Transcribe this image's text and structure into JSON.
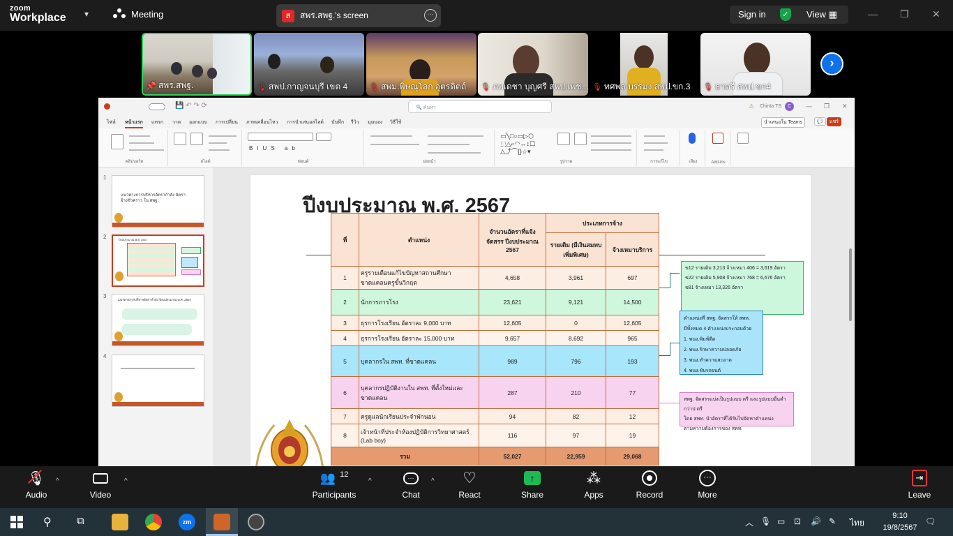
{
  "app": {
    "brand_line1": "zoom",
    "brand_line2": "Workplace",
    "meeting_label": "Meeting",
    "share_badge": "ส",
    "share_title": "สพร.สพฐ.'s screen",
    "signin": "Sign in",
    "view": "View"
  },
  "participants_strip": [
    {
      "name": "สพร.สพฐ.",
      "muted": false,
      "pinned": true
    },
    {
      "name": "สพป.กาญจนบุรี เขต 4",
      "muted": true
    },
    {
      "name": "สพม.พิษณุโลก อุตรดิตถ์",
      "muted": true
    },
    {
      "name": "ภพเดชา บุญศรี สพป.เพช...",
      "muted": true
    },
    {
      "name": "ทศพล บรรมง สพป.ขก.3",
      "muted": true
    },
    {
      "name": "ธาตรี สพป.ขก4",
      "muted": true
    }
  ],
  "ppt": {
    "search_placeholder": "ค้นหา",
    "user": "Chinta TS",
    "tabs": [
      "ไฟล์",
      "หน้าแรก",
      "แทรก",
      "วาด",
      "ออกแบบ",
      "การเปลี่ยน",
      "ภาพเคลื่อนไหว",
      "การนำเสนอสไลด์",
      "บันทึก",
      "รีวิว",
      "มุมมอง",
      "วิธีใช้"
    ],
    "active_tab": "หน้าแรก",
    "ribbon_groups": [
      "คลิปบอร์ด",
      "สไลด์",
      "ฟอนต์",
      "ย่อหน้า",
      "รูปวาด",
      "การแก้ไข",
      "เสียง",
      "Add-ins"
    ],
    "teams_btn": "นำเสนอใน Teams",
    "share_btn": "แชร์",
    "slide_numbers": [
      "1",
      "2",
      "3",
      "4"
    ],
    "thumb_1_title": "แนวทางการบริหารอัตรากำลัง อัตราจ้างชั่วคราว ใน สพฐ.",
    "thumb_2_title": "ปีงบประมาณ พ.ศ. 2567",
    "thumb_3_title": "แนวทางการบริหารอัตรากำลัง ปีงบประมาณ พ.ศ. 2567"
  },
  "slide": {
    "title": "ปีงบประมาณ พ.ศ. 2567",
    "headers": {
      "no": "ที่",
      "position": "ตำแหน่ง",
      "allocated": "จำนวนอัตราที่แจ้งจัดสรร ปีงบประมาณ 2567",
      "employment_type": "ประเภทการจ้าง",
      "original": "รายเดิม (มีเงินสมทบเพิ่มพิเศษ)",
      "contract": "จ้างเหมาบริการ"
    },
    "rows": [
      {
        "no": "1",
        "position": "ครูรายเดือนแก้ไขปัญหาสถานศึกษาขาดแคลนครูขั้นวิกฤต",
        "allocated": "4,658",
        "original": "3,961",
        "contract": "697"
      },
      {
        "no": "2",
        "position": "นักการภารโรง",
        "allocated": "23,621",
        "original": "9,121",
        "contract": "14,500"
      },
      {
        "no": "3",
        "position": "ธุรการโรงเรียน อัตราละ 9,000 บาท",
        "allocated": "12,605",
        "original": "0",
        "contract": "12,605"
      },
      {
        "no": "4",
        "position": "ธุรการโรงเรียน อัตราละ 15,000 บาท",
        "allocated": "9,657",
        "original": "8,692",
        "contract": "965"
      },
      {
        "no": "5",
        "position": "บุคลากรใน สพท. ที่ขาดแคลน",
        "allocated": "989",
        "original": "796",
        "contract": "193"
      },
      {
        "no": "6",
        "position": "บุคลากรปฏิบัติงานใน สพท. ที่ตั้งใหม่และขาดแคลน",
        "allocated": "287",
        "original": "210",
        "contract": "77"
      },
      {
        "no": "7",
        "position": "ครูดูแลนักเรียนประจำพักนอน",
        "allocated": "94",
        "original": "82",
        "contract": "12"
      },
      {
        "no": "8",
        "position": "เจ้าหน้าที่ประจำห้องปฏิบัติการวิทยาศาสตร์ (Lab boy)",
        "allocated": "116",
        "original": "97",
        "contract": "19"
      }
    ],
    "total": {
      "label": "รวม",
      "allocated": "52,027",
      "original": "22,959",
      "contract": "29,068"
    },
    "note_green": [
      "ข12 รายเดิม 3,213 จ้างเหมา 406 = 3,619 อัตรา",
      "ข22 รายเดิม 5,908 จ้างเหมา 768 = 6,676 อัตรา",
      "ข81 จ้างเหมา 13,326 อัตรา"
    ],
    "note_blue": [
      "ตำแหน่งที่ สพฐ. จัดสรรให้ สพท.",
      "มีทั้งหมด 4 ตำแหน่งประกอบด้วย",
      "1. พนง.พิมพ์ดีด",
      "2. พนง.รักษาความปลอดภัย",
      "3. พนง.ทำความสะอาด",
      "4. พนง.ขับรถยนต์"
    ],
    "note_pink": [
      "สพฐ. จัดสรรแบ่งเป็นรูปแบบ ตรี และรูปแบบอื่นต่ำกว่าป.ตรี",
      "โดย สพท. นำอัตราที่ได้รับไปจัดหาตำแหน่ง",
      "ตามความต้องการของ สพท."
    ]
  },
  "controls": {
    "audio": "Audio",
    "video": "Video",
    "participants": "Participants",
    "participant_count": "12",
    "chat": "Chat",
    "react": "React",
    "share": "Share",
    "apps": "Apps",
    "record": "Record",
    "more": "More",
    "leave": "Leave"
  },
  "taskbar": {
    "lang": "ไทย",
    "time": "9:10",
    "date": "19/8/2567"
  },
  "colors": {
    "zoom_blue": "#0e72ed",
    "share_green": "#1db954",
    "ppt_orange": "#c43e1c",
    "active_speaker": "#2fd65a"
  }
}
